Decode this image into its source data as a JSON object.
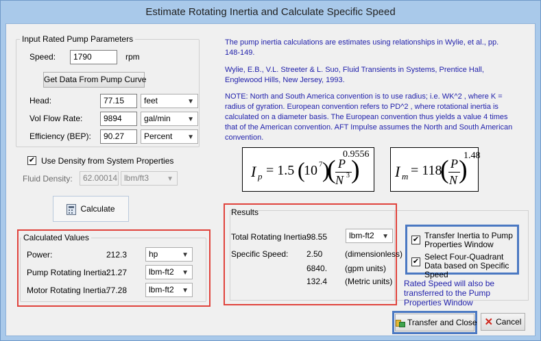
{
  "window": {
    "title": "Estimate Rotating Inertia and Calculate Specific Speed"
  },
  "input_group": {
    "title": "Input Rated Pump Parameters",
    "speed_label": "Speed:",
    "speed_value": "1790",
    "speed_unit": "rpm",
    "get_data_button": "Get Data From Pump Curve",
    "head_label": "Head:",
    "head_value": "77.15",
    "head_unit": "feet",
    "flow_label": "Vol Flow Rate:",
    "flow_value": "9894",
    "flow_unit": "gal/min",
    "eff_label": "Efficiency (BEP):",
    "eff_value": "90.27",
    "eff_unit": "Percent"
  },
  "density": {
    "checkbox_label": "Use Density from System Properties",
    "checked": true,
    "fluid_label": "Fluid Density:",
    "fluid_value": "62.00014",
    "fluid_unit": "lbm/ft3"
  },
  "calculate_button": "Calculate",
  "calculated": {
    "title": "Calculated Values",
    "power_label": "Power:",
    "power_value": "212.3",
    "power_unit": "hp",
    "pump_label": "Pump Rotating Inertia:",
    "pump_value": "21.27",
    "pump_unit": "lbm-ft2",
    "motor_label": "Motor Rotating Inertia:",
    "motor_value": "77.28",
    "motor_unit": "lbm-ft2"
  },
  "notes": {
    "line1": "The pump inertia calculations are estimates using relationships in Wylie, et al., pp. 148-149.",
    "line2": "Wylie, E.B., V.L. Streeter & L. Suo, Fluid Transients in Systems, Prentice Hall, Englewood Hills, New Jersey, 1993.",
    "line3": "NOTE:     North and South America convention is to use radius; i.e. WK^2 , where K = radius of gyration. European convention refers to PD^2 , where rotational inertia is calculated on a diameter basis. The European convention thus yields a value 4 times that of the American convention. AFT Impulse assumes the North and South American convention."
  },
  "formulas": {
    "ip_lhs": "I",
    "ip_sub": "p",
    "ip_coef": " = 1.5",
    "ip_ten": "10",
    "ip_exp7": "7",
    "ip_num": "P",
    "ip_den": "N",
    "ip_den_exp": "3",
    "ip_power": "0.9556",
    "im_lhs": "I",
    "im_sub": "m",
    "im_coef": " = 118",
    "im_num": "P",
    "im_den": "N",
    "im_power": "1.48"
  },
  "results": {
    "title": "Results",
    "total_label": "Total Rotating Inertia:",
    "total_value": "98.55",
    "total_unit": "lbm-ft2",
    "specific_label": "Specific Speed:",
    "ss_value1": "2.50",
    "ss_unit1": "(dimensionless)",
    "ss_value2": "6840.",
    "ss_unit2": "(gpm units)",
    "ss_value3": "132.4",
    "ss_unit3": "(Metric units)"
  },
  "transfer_options": {
    "opt1": "Transfer Inertia to Pump Properties Window",
    "opt1_checked": true,
    "opt2": "Select Four-Quadrant Data based on Specific Speed",
    "opt2_checked": true,
    "note": "Rated Speed will also be transferred to the Pump Properties Window"
  },
  "buttons": {
    "transfer": "Transfer and Close",
    "cancel": "Cancel"
  },
  "colors": {
    "highlight_red": "#e0423b",
    "highlight_blue": "#4a78c2",
    "note_text": "#1e1eaa"
  }
}
